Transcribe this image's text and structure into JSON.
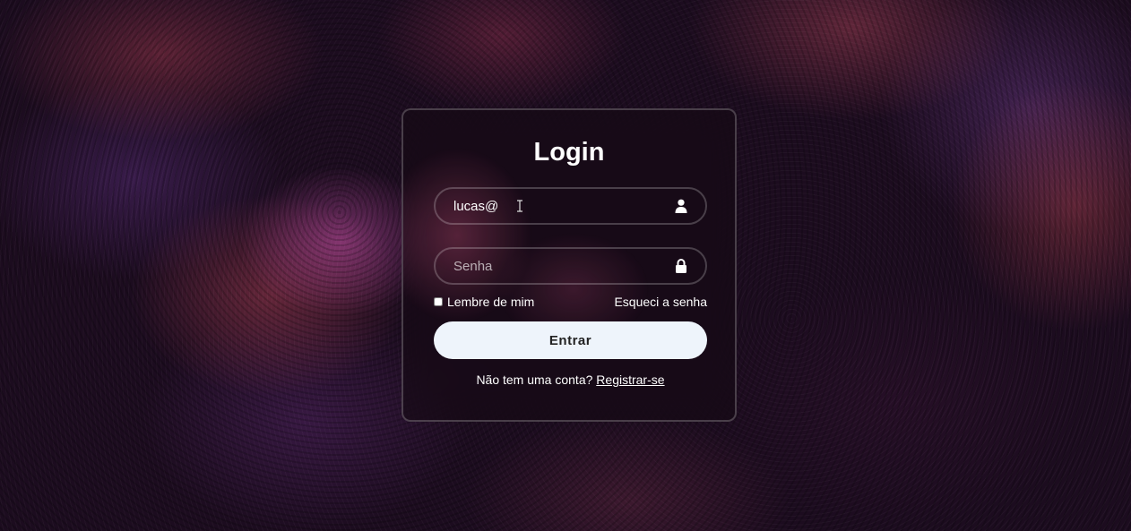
{
  "login": {
    "title": "Login",
    "username": {
      "value": "lucas@",
      "placeholder": ""
    },
    "password": {
      "value": "",
      "placeholder": "Senha"
    },
    "remember_label": "Lembre de mim",
    "forgot_label": "Esqueci a senha",
    "submit_label": "Entrar",
    "register_prompt": "Não tem uma conta?",
    "register_link": "Registrar-se"
  },
  "icons": {
    "username": "user-icon",
    "password": "lock-icon",
    "cursor": "text-cursor-icon"
  },
  "colors": {
    "button_bg": "#eef4fb",
    "text": "#ffffff"
  }
}
